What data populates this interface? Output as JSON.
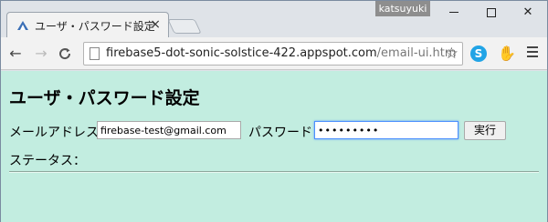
{
  "window": {
    "user_badge": "katsuyuki",
    "min_glyph": "",
    "max_glyph": "",
    "close_glyph": "✕"
  },
  "tab": {
    "title": "ユーザ・パスワード設定",
    "close_glyph": "×"
  },
  "toolbar": {
    "back_glyph": "←",
    "forward_glyph": "→",
    "reload_glyph": "C",
    "url_host": "firebase5-dot-sonic-solstice-422.appspot.com",
    "url_path": "/email-ui.htm",
    "star_glyph": "☆",
    "skype_glyph": "S",
    "hand_glyph": "✋"
  },
  "page": {
    "title": "ユーザ・パスワード設定",
    "email_label": "メールアドレス",
    "email_value": "firebase-test@gmail.com",
    "password_label": "パスワード",
    "password_value": "•••••••••",
    "execute_button": "実行",
    "status_label": "ステータス：",
    "status_value": ""
  },
  "colors": {
    "page_background": "#c2ede0",
    "focus_border": "#4d90fe"
  }
}
